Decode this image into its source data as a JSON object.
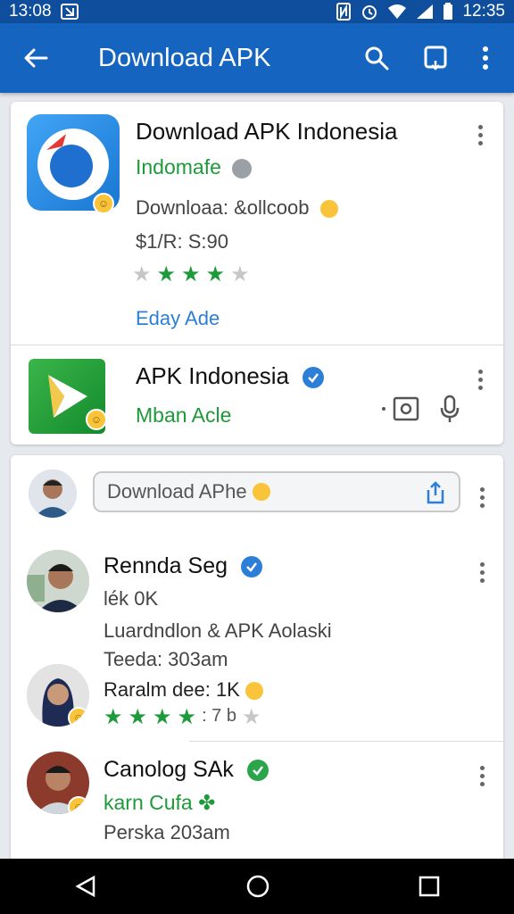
{
  "status_bar": {
    "time_left": "13:08",
    "time_right": "12:35"
  },
  "app_bar": {
    "title": "Download APK"
  },
  "card1": {
    "app1": {
      "title": "Download APK Indonesia",
      "developer": "Indomafe",
      "downloads": "Downloaa: &ollcoob",
      "price": "$1/R: S:90",
      "rating_stars": 3,
      "rating_max": 5,
      "ads_label": "Eday Ade"
    },
    "app2": {
      "title": "APK Indonesia",
      "subtitle": "Mban Acle"
    }
  },
  "card2": {
    "search_placeholder": "Download APhe",
    "reviews": [
      {
        "name": "Rennda Seg",
        "line1": "lék 0K",
        "line2": "Luardndlon & APK Aolaski",
        "line3": "Teeda: 303am"
      },
      {
        "rating_text": "Raralm dee: 1K",
        "stars_green": 4,
        "stars_text": ": 7 b"
      },
      {
        "name": "Canolog SAk",
        "line1": "karn Cufa",
        "line2": "Perska 203am"
      }
    ]
  },
  "colors": {
    "app_bar": "#1565c0",
    "status_bar": "#0f4e9c",
    "accent_green": "#1e9a3a",
    "link_blue": "#2b7fd6"
  }
}
